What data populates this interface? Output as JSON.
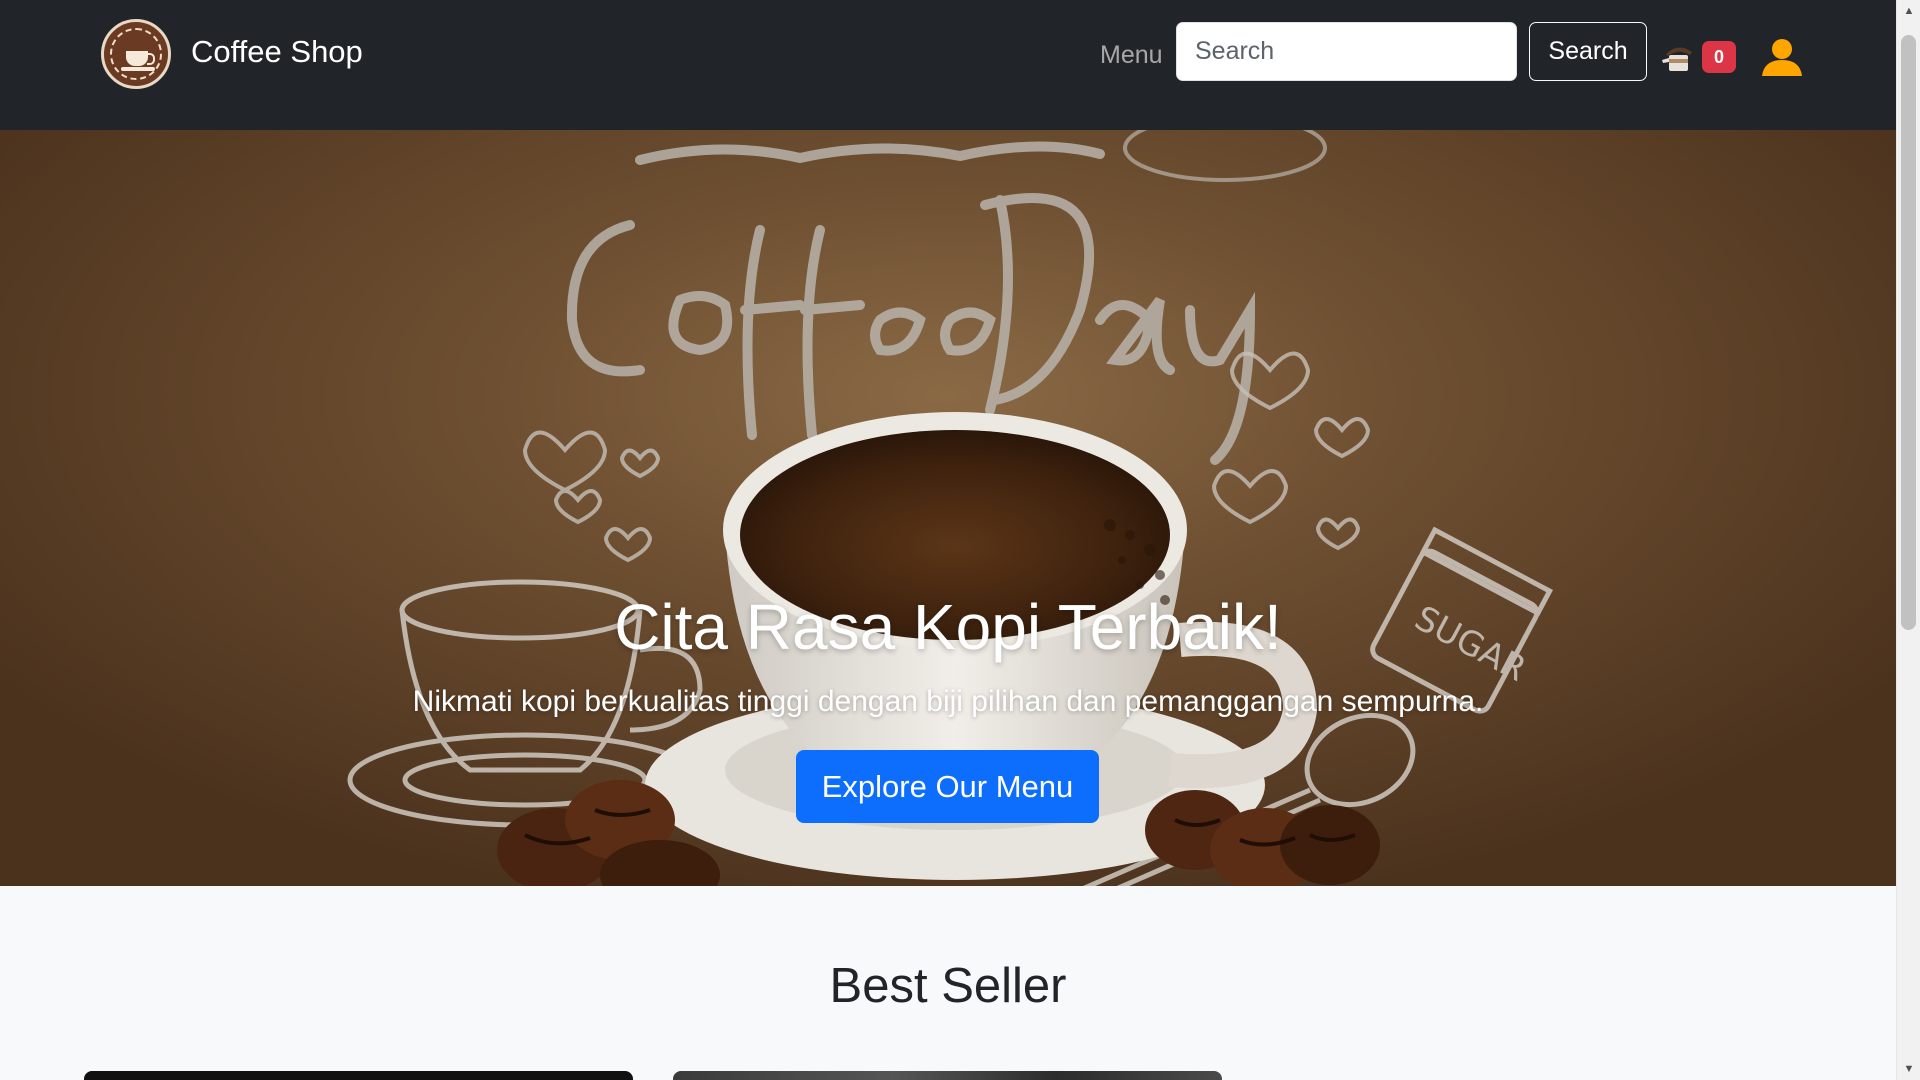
{
  "navbar": {
    "brand_name": "Coffee Shop",
    "menu_label": "Menu",
    "search_placeholder": "Search",
    "search_button_label": "Search",
    "cart_count": "0"
  },
  "hero": {
    "title": "Cita Rasa Kopi Terbaik!",
    "subtitle": "Nikmati kopi berkualitas tinggi dengan biji pilihan dan pemanggangan sempurna.",
    "cta_label": "Explore Our Menu"
  },
  "best_seller": {
    "title": "Best Seller"
  },
  "colors": {
    "navbar_bg": "#212529",
    "primary": "#0d6efd",
    "badge": "#dc3545",
    "user_icon": "#ffa500"
  }
}
